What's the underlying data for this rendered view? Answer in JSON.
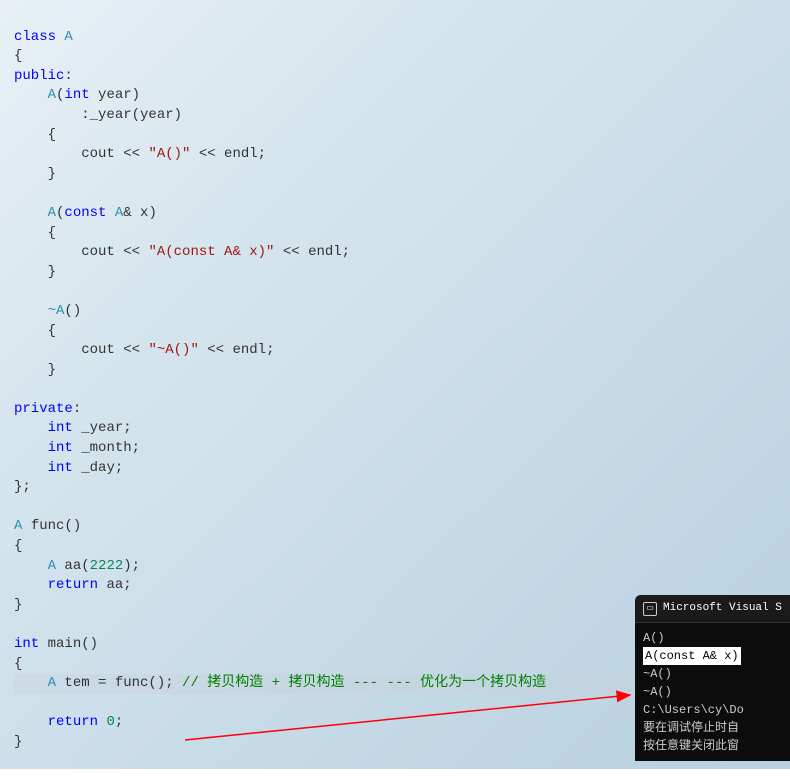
{
  "code": {
    "l1_class": "class",
    "l1_name": "A",
    "l2_brace": "{",
    "l3_public": "public",
    "l3_colon": ":",
    "l4_fn": "A",
    "l4_ptype": "int",
    "l4_param": "year",
    "l5_init": ":_year(year)",
    "l6_brace": "{",
    "l7_cout": "cout << ",
    "l7_str": "\"A()\"",
    "l7_endl": " << endl;",
    "l8_brace": "}",
    "l10_fn": "A",
    "l10_ptype": "const",
    "l10_cls": "A",
    "l10_param": "& x",
    "l11_brace": "{",
    "l12_cout": "cout << ",
    "l12_str": "\"A(const A& x)\"",
    "l12_endl": " << endl;",
    "l13_brace": "}",
    "l15_fn": "~A",
    "l16_brace": "{",
    "l17_cout": "cout << ",
    "l17_str": "\"~A()\"",
    "l17_endl": " << endl;",
    "l18_brace": "}",
    "l20_private": "private",
    "l20_colon": ":",
    "l21_type": "int",
    "l21_name": "_year;",
    "l22_type": "int",
    "l22_name": "_month;",
    "l23_type": "int",
    "l23_name": "_day;",
    "l24_end": "};",
    "l26_ret": "A",
    "l26_fn": "func",
    "l27_brace": "{",
    "l28_cls": "A",
    "l28_var": "aa",
    "l28_arg": "2222",
    "l29_kw": "return",
    "l29_var": "aa;",
    "l30_brace": "}",
    "l32_ret": "int",
    "l32_fn": "main",
    "l33_brace": "{",
    "l34_cls": "A",
    "l34_var": "tem = func();",
    "l34_cmt": "// 拷贝构造 + 拷贝构造 --- --- 优化为一个拷贝构造",
    "l36_kw": "return",
    "l36_val": "0",
    "l36_semi": ";",
    "l37_brace": "}"
  },
  "console": {
    "title": "Microsoft Visual S",
    "lines": [
      "A()",
      "A(const A& x)",
      "~A()",
      "~A()",
      "",
      "C:\\Users\\cy\\Do",
      "要在调试停止时自",
      "按任意键关闭此窗"
    ],
    "highlight_index": 1
  }
}
